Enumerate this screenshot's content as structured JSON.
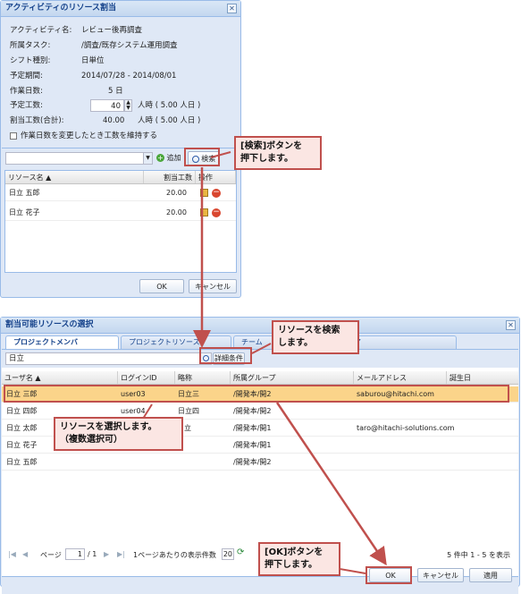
{
  "dialog1": {
    "title": "アクティビティのリソース割当",
    "fields": [
      {
        "label": "アクティビティ名:",
        "value": "レビュー後再調査"
      },
      {
        "label": "所属タスク:",
        "value": "/調査/既存システム運用調査"
      },
      {
        "label": "シフト種別:",
        "value": "日単位"
      },
      {
        "label": "予定期間:",
        "value": "2014/07/28 - 2014/08/01"
      },
      {
        "label": "作業日数:",
        "value": "5 日"
      }
    ],
    "planned_work": {
      "label": "予定工数:",
      "value": "40",
      "unit": "人時 ( 5.00 人日 )"
    },
    "assigned_total": {
      "label": "割当工数(合計):",
      "value": "40.00",
      "unit": "人時 ( 5.00 人日 )"
    },
    "keep_checkbox_label": "作業日数を変更したとき工数を維持する",
    "add_label": "追加",
    "search_label": "検索",
    "grid_headers": [
      "リソース名 ▲",
      "割当工数",
      "操作"
    ],
    "rows": [
      {
        "name": "日立 五郎",
        "work": "20.00"
      },
      {
        "name": "日立 花子",
        "work": "20.00"
      }
    ],
    "ok_label": "OK",
    "cancel_label": "キャンセル"
  },
  "dialog2": {
    "title": "割当可能リソースの選択",
    "tabs": [
      "プロジェクトメンバ",
      "プロジェクトリソース",
      "チーム",
      "ア"
    ],
    "search_value": "日立",
    "detail_label": "詳細条件",
    "headers": [
      "ユーザ名 ▲",
      "ログインID",
      "略称",
      "所属グループ",
      "メールアドレス",
      "誕生日"
    ],
    "rows": [
      {
        "name": "日立 三郎",
        "login": "user03",
        "abbr": "日立三",
        "group": "/開発本/開2",
        "mail": "saburou@hitachi.com"
      },
      {
        "name": "日立 四郎",
        "login": "user04",
        "abbr": "日立四",
        "group": "/開発本/開2",
        "mail": ""
      },
      {
        "name": "日立 太郎",
        "login": "",
        "abbr": "立",
        "group": "/開発本/開1",
        "mail": "taro@hitachi-solutions.com"
      },
      {
        "name": "日立 花子",
        "login": "",
        "abbr": "",
        "group": "/開発本/開1",
        "mail": ""
      },
      {
        "name": "日立 五郎",
        "login": "",
        "abbr": "",
        "group": "/開発本/開2",
        "mail": ""
      }
    ],
    "paging": {
      "page_label": "ページ",
      "page_value": "1",
      "page_total": "/ 1",
      "per_page_label": "1ページあたりの表示件数",
      "per_page_value": "20",
      "count_text": "5 件中 1 - 5 を表示"
    },
    "ok_label": "OK",
    "cancel_label": "キャンセル",
    "apply_label": "適用"
  },
  "callouts": {
    "search_btn": "[検索]ボタンを\n押下します。",
    "search_resource": "リソースを検索\nします。",
    "select_resource": "リソースを選択します。\n（複数選択可）",
    "ok_btn": "[OK]ボタンを\n押下します。"
  },
  "colors": {
    "callout_border": "#c0504d",
    "callout_fill": "#fbe6e3",
    "selected_row": "#fbd48a",
    "header_blue": "#15428b"
  }
}
